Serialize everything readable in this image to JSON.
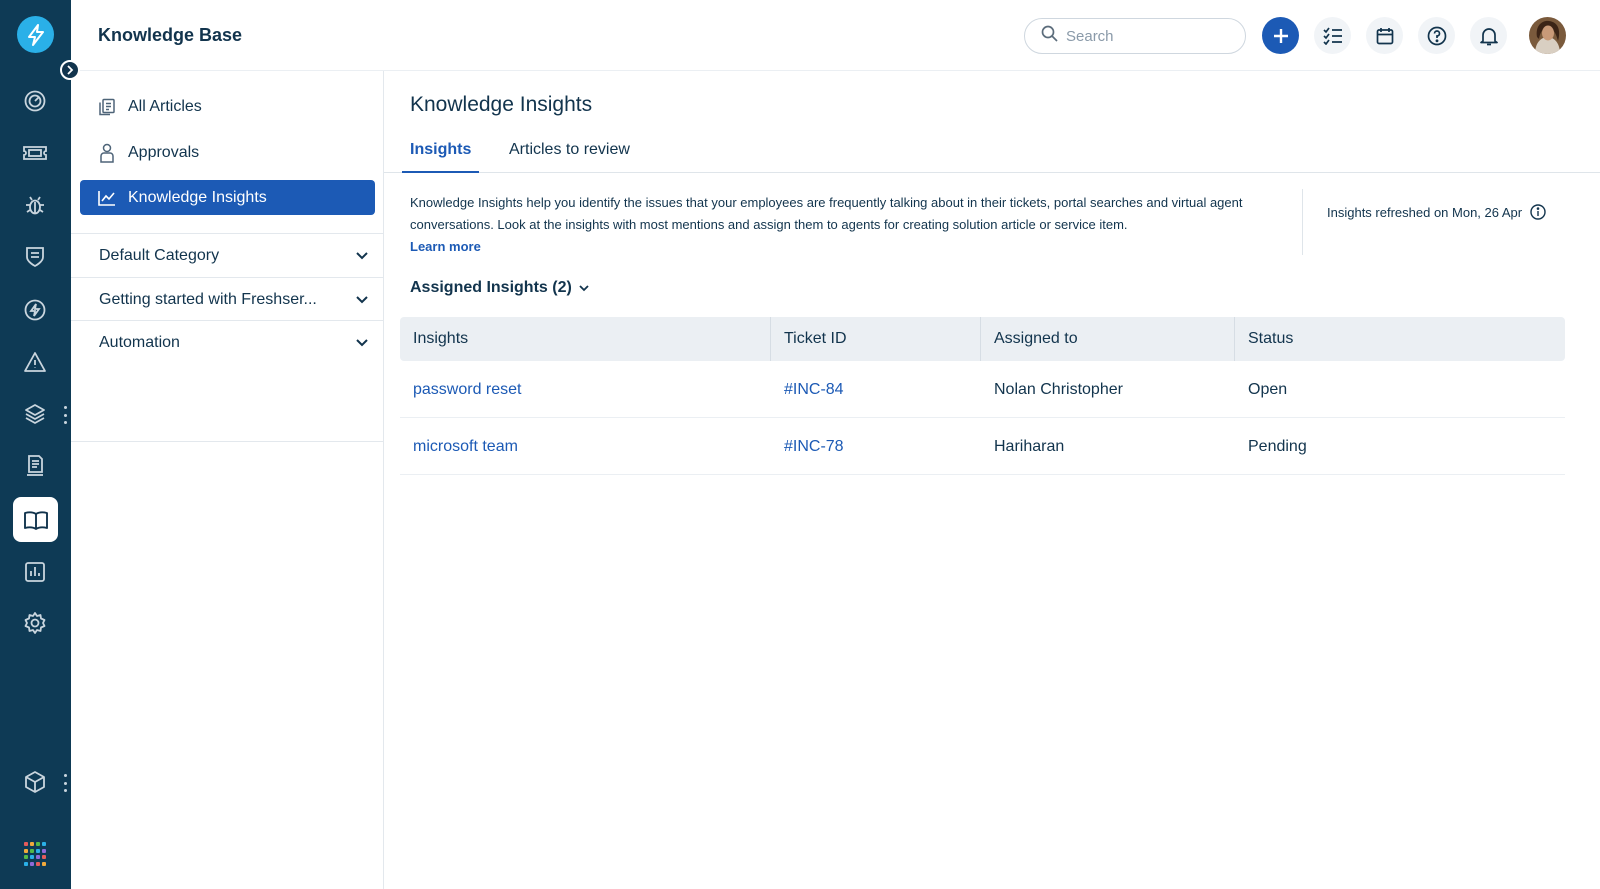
{
  "app": {
    "title": "Knowledge Base"
  },
  "header": {
    "search_placeholder": "Search"
  },
  "rail": {
    "items": [
      {
        "icon": "dashboard-icon"
      },
      {
        "icon": "tickets-icon"
      },
      {
        "icon": "problems-icon"
      },
      {
        "icon": "changes-icon"
      },
      {
        "icon": "releases-icon"
      },
      {
        "icon": "alerts-icon"
      },
      {
        "icon": "assets-icon"
      },
      {
        "icon": "contracts-icon"
      },
      {
        "icon": "knowledge-base-icon",
        "active": true
      },
      {
        "icon": "reports-icon"
      },
      {
        "icon": "admin-icon"
      }
    ]
  },
  "subnav": {
    "items": [
      {
        "label": "All Articles",
        "icon": "articles-icon"
      },
      {
        "label": "Approvals",
        "icon": "person-icon"
      },
      {
        "label": "Knowledge Insights",
        "icon": "chart-line-icon",
        "active": true
      }
    ],
    "categories": [
      {
        "label": "Default Category"
      },
      {
        "label": "Getting started with Freshser..."
      },
      {
        "label": "Automation"
      }
    ]
  },
  "main": {
    "title": "Knowledge Insights",
    "tabs": [
      {
        "label": "Insights",
        "active": true
      },
      {
        "label": "Articles to review"
      }
    ],
    "description": "Knowledge Insights help you identify the issues that your employees are frequently talking about in their tickets, portal searches and virtual agent conversations. Look at the insights with most mentions and assign them to agents for creating solution article or service item.",
    "learn_more": "Learn more",
    "refreshed": "Insights refreshed on Mon, 26 Apr",
    "section_title": "Assigned Insights (2)",
    "table": {
      "columns": [
        "Insights",
        "Ticket ID",
        "Assigned to",
        "Status"
      ],
      "rows": [
        {
          "insight": "password reset",
          "ticket": "#INC-84",
          "assigned": "Nolan Christopher",
          "status": "Open"
        },
        {
          "insight": "microsoft team",
          "ticket": "#INC-78",
          "assigned": "Hariharan",
          "status": "Pending"
        }
      ]
    }
  },
  "colors": {
    "rail_bg": "#0e3a55",
    "accent": "#1c5ab5",
    "logo": "#2ab0e8"
  }
}
